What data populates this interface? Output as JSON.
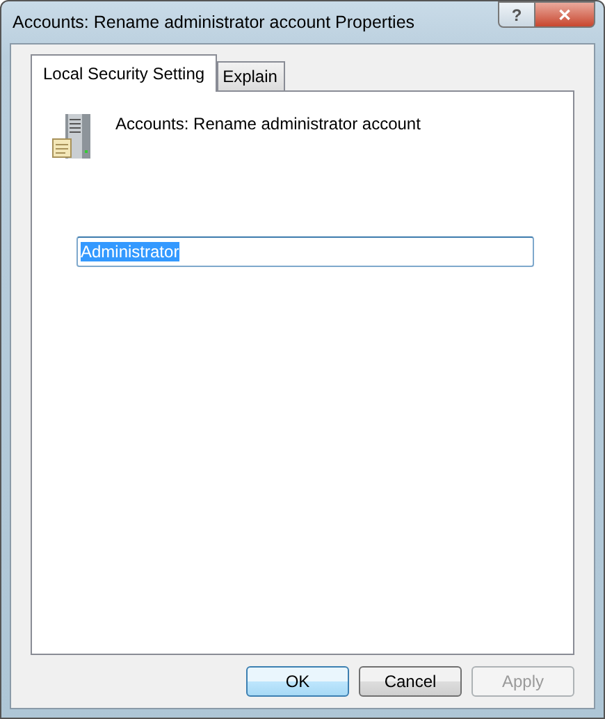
{
  "window": {
    "title": "Accounts: Rename administrator account Properties",
    "buttons": [
      {
        "kind": "help",
        "label": "?"
      },
      {
        "kind": "close",
        "label": "✕"
      }
    ]
  },
  "tabs": [
    {
      "label": "Local Security Setting",
      "selected": true
    },
    {
      "label": "Explain",
      "selected": false
    }
  ],
  "policy": {
    "name": "Accounts: Rename administrator account"
  },
  "field": {
    "value": "Administrator",
    "text_selected": true
  },
  "buttons": [
    {
      "label": "OK",
      "default": true,
      "disabled": false
    },
    {
      "label": "Cancel",
      "default": false,
      "disabled": false
    },
    {
      "label": "Apply",
      "default": false,
      "disabled": true
    }
  ]
}
